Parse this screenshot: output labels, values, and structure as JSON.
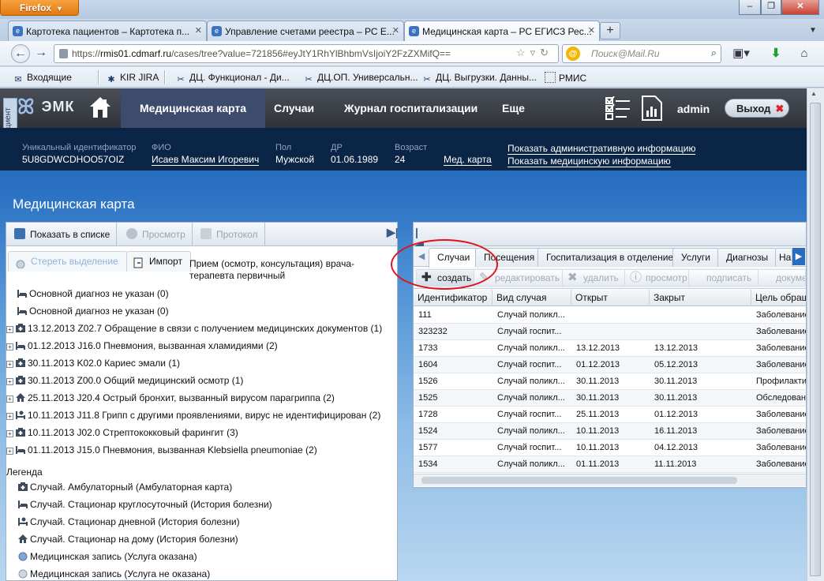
{
  "browser": {
    "app_button": "Firefox",
    "tabs": [
      {
        "label": "Картотека пациентов – Картотека п..."
      },
      {
        "label": "Управление счетами реестра – РС Е..."
      },
      {
        "label": "Медицинская карта – РС ЕГИСЗ Рес..."
      }
    ],
    "new_tab": "+",
    "url_scheme": "https://",
    "url_host": "rmis01.cdmarf.ru",
    "url_path": "/cases/tree?value=721856#eyJtY1RhYlBhbmVsIjoiY2FzZXMifQ==",
    "search_placeholder": "Поиск@Mail.Ru",
    "bookmarks": [
      "Входящие",
      "KIR JIRA",
      "ДЦ. Функционал - Ди...",
      "ДЦ.ОП. Универсальн...",
      "ДЦ. Выгрузки. Данны...",
      "РМИС"
    ]
  },
  "side_tab": "Пациент",
  "header": {
    "logo": "ЭМК",
    "nav": [
      "Медицинская карта",
      "Случаи",
      "Журнал госпитализации",
      "Еще"
    ],
    "user": "admin",
    "logout": "Выход"
  },
  "patient": {
    "uid_label": "Уникальный идентификатор",
    "uid": "5U8GDWCDHOO57OIZ",
    "fio_label": "ФИО",
    "fio": "Исаев Максим Игоревич",
    "sex_label": "Пол",
    "sex": "Мужской",
    "dob_label": "ДР",
    "dob": "01.06.1989",
    "age_label": "Возраст",
    "age": "24",
    "card_link": "Мед. карта",
    "admin_link": "Показать административную информацию",
    "med_link": "Показать медицинскую информацию"
  },
  "page_title": "Медицинская карта",
  "left_panel": {
    "toolbar": [
      "Показать в списке",
      "Просмотр",
      "Протокол"
    ],
    "clear_selection": "Стереть выделение",
    "import": "Импорт",
    "context": "Прием (осмотр, консультация) врача-терапевта первичный",
    "tree": [
      {
        "text": "Основной диагноз не указан (0)",
        "expand": false,
        "icon": "bed"
      },
      {
        "text": "Основной диагноз не указан (0)",
        "expand": false,
        "icon": "bed"
      },
      {
        "text": "13.12.2013 Z02.7 Обращение в связи с получением медицинских документов (1)",
        "expand": true,
        "icon": "amb"
      },
      {
        "text": "01.12.2013 J16.0 Пневмония, вызванная хламидиями (2)",
        "expand": true,
        "icon": "bed"
      },
      {
        "text": "30.11.2013 K02.0 Кариес эмали (1)",
        "expand": true,
        "icon": "amb"
      },
      {
        "text": "30.11.2013 Z00.0 Общий медицинский осмотр (1)",
        "expand": true,
        "icon": "amb"
      },
      {
        "text": "25.11.2013 J20.4 Острый бронхит, вызванный вирусом парагриппа (2)",
        "expand": true,
        "icon": "home"
      },
      {
        "text": "10.11.2013 J11.8 Грипп с другими проявлениями, вирус не идентифицирован (2)",
        "expand": true,
        "icon": "day"
      },
      {
        "text": "10.11.2013 J02.0 Стрептококковый фарингит (3)",
        "expand": true,
        "icon": "amb"
      },
      {
        "text": "01.11.2013 J15.0 Пневмония, вызванная Klebsiella pneumoniae (2)",
        "expand": true,
        "icon": "bed"
      }
    ],
    "legend_title": "Легенда",
    "legend": [
      {
        "text": "Случай. Амбулаторный (Амбулаторная карта)",
        "icon": "amb"
      },
      {
        "text": "Случай. Стационар круглосуточный (История болезни)",
        "icon": "bed"
      },
      {
        "text": "Случай. Стационар дневной (История болезни)",
        "icon": "day"
      },
      {
        "text": "Случай. Стационар на дому (История болезни)",
        "icon": "home"
      },
      {
        "text": "Медицинская запись (Услуга оказана)",
        "icon": "dot-blue"
      },
      {
        "text": "Медицинская запись (Услуга не оказана)",
        "icon": "dot-grey"
      }
    ]
  },
  "right_panel": {
    "tabs": [
      "Случаи",
      "Посещения",
      "Госпитализация в отделение",
      "Услуги",
      "Диагнозы",
      "На"
    ],
    "buttons": [
      "создать",
      "редактировать",
      "удалить",
      "просмотр",
      "подписать",
      "докуме"
    ],
    "columns": [
      "Идентификатор",
      "Вид случая",
      "Открыт",
      "Закрыт",
      "Цель обращения"
    ],
    "rows": [
      [
        "111",
        "Случай поликл...",
        "",
        "",
        "Заболевание"
      ],
      [
        "323232",
        "Случай госпит...",
        "",
        "",
        "Заболевание"
      ],
      [
        "1733",
        "Случай поликл...",
        "13.12.2013",
        "13.12.2013",
        "Заболевание"
      ],
      [
        "1604",
        "Случай госпит...",
        "01.12.2013",
        "05.12.2013",
        "Заболевание"
      ],
      [
        "1526",
        "Случай поликл...",
        "30.11.2013",
        "30.11.2013",
        "Профилактика"
      ],
      [
        "1525",
        "Случай поликл...",
        "30.11.2013",
        "30.11.2013",
        "Обследование"
      ],
      [
        "1728",
        "Случай госпит...",
        "25.11.2013",
        "01.12.2013",
        "Заболевание"
      ],
      [
        "1524",
        "Случай поликл...",
        "10.11.2013",
        "16.11.2013",
        "Заболевание"
      ],
      [
        "1577",
        "Случай госпит...",
        "10.11.2013",
        "04.12.2013",
        "Заболевание"
      ],
      [
        "1534",
        "Случай поликл...",
        "01.11.2013",
        "11.11.2013",
        "Заболевание"
      ]
    ]
  },
  "colors": {
    "header_bg": "#2f3339",
    "nav_active": "#3d4b6c",
    "info_bg": "#0b2547",
    "annotation": "#e0121a"
  }
}
